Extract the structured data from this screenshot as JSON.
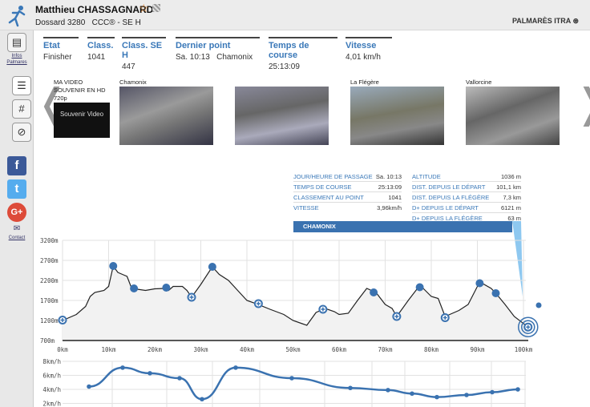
{
  "header": {
    "name": "Matthieu CHASSAGNARD",
    "dossard": "Dossard 3280   CCC® - SE H",
    "palmares": "PALMARÈS ITRA ⊛"
  },
  "sidebar": {
    "infos": "Infos",
    "palmares": "Palmares",
    "contact": "Contact"
  },
  "stats": [
    {
      "label": "Etat",
      "value": "Finisher"
    },
    {
      "label": "Class.",
      "value": "1041"
    },
    {
      "label": "Class. SE H",
      "value": "447"
    },
    {
      "label": "Dernier point",
      "value": "Sa. 10:13   Chamonix"
    },
    {
      "label": "Temps de course",
      "value": "25:13:09"
    },
    {
      "label": "Vitesse",
      "value": "4,01 km/h"
    }
  ],
  "videos": {
    "souvenir": "MA VIDEO SOUVENIR EN HD 720p",
    "souvenir_img": "Souvenir Video",
    "thumbs": [
      "Chamonix",
      "",
      "La Flégère",
      "Vallorcine"
    ]
  },
  "info_left": [
    [
      "JOUR/HEURE DE PASSAGE",
      "Sa. 10:13"
    ],
    [
      "TEMPS DE COURSE",
      "25:13:09"
    ],
    [
      "CLASSEMENT AU POINT",
      "1041"
    ],
    [
      "VITESSE",
      "3,96km/h"
    ]
  ],
  "info_right": [
    [
      "ALTITUDE",
      "1036 m"
    ],
    [
      "DIST. DEPUIS LE DÉPART",
      "101,1 km"
    ],
    [
      "DIST. DEPUIS LA FLÉGÈRE",
      "7,3 km"
    ],
    [
      "D+ DEPUIS LE DÉPART",
      "6121 m"
    ],
    [
      "D+ DEPUIS LA FLÉGÈRE",
      "63 m"
    ]
  ],
  "banner": "CHAMONIX",
  "colors": {
    "accent": "#3a72b0",
    "line": "#222222",
    "fill": "#f2f2f2"
  },
  "chart_data": [
    {
      "type": "area",
      "xlim": [
        0,
        100
      ],
      "ylim": [
        700,
        3200
      ],
      "xticks": [
        "0km",
        "10km",
        "20km",
        "30km",
        "40km",
        "50km",
        "60km",
        "70km",
        "80km",
        "90km",
        "100km"
      ],
      "yticks": [
        "3200m",
        "2700m",
        "2200m",
        "1700m",
        "1200m",
        "700m"
      ],
      "profile": [
        [
          0,
          1200
        ],
        [
          3,
          1350
        ],
        [
          5,
          1550
        ],
        [
          6,
          1800
        ],
        [
          7,
          1900
        ],
        [
          9,
          1950
        ],
        [
          10,
          2050
        ],
        [
          11,
          2560
        ],
        [
          12,
          2400
        ],
        [
          13,
          2350
        ],
        [
          14,
          2300
        ],
        [
          15,
          2000
        ],
        [
          18,
          1950
        ],
        [
          20,
          1990
        ],
        [
          22,
          2000
        ],
        [
          23,
          1950
        ],
        [
          24,
          2050
        ],
        [
          26,
          2050
        ],
        [
          27,
          1950
        ],
        [
          28,
          1780
        ],
        [
          30,
          2100
        ],
        [
          32.5,
          2540
        ],
        [
          34,
          2350
        ],
        [
          36,
          2200
        ],
        [
          38,
          1950
        ],
        [
          40,
          1700
        ],
        [
          42,
          1620
        ],
        [
          45,
          1480
        ],
        [
          48,
          1350
        ],
        [
          50,
          1200
        ],
        [
          52,
          1120
        ],
        [
          53,
          1080
        ],
        [
          55,
          1400
        ],
        [
          57,
          1500
        ],
        [
          59,
          1420
        ],
        [
          60,
          1350
        ],
        [
          62,
          1380
        ],
        [
          64,
          1700
        ],
        [
          66,
          2000
        ],
        [
          68,
          1900
        ],
        [
          70,
          1600
        ],
        [
          71.5,
          1500
        ],
        [
          72.5,
          1300
        ],
        [
          75,
          1700
        ],
        [
          77,
          2000
        ],
        [
          78,
          2030
        ],
        [
          80,
          1800
        ],
        [
          81.5,
          1750
        ],
        [
          83,
          1300
        ],
        [
          86,
          1450
        ],
        [
          88,
          1600
        ],
        [
          90,
          2050
        ],
        [
          91,
          2130
        ],
        [
          93,
          2000
        ],
        [
          94,
          1880
        ],
        [
          96,
          1600
        ],
        [
          98,
          1300
        ],
        [
          101,
          1036
        ]
      ],
      "checkpoints_filled": [
        [
          11,
          2560
        ],
        [
          15.5,
          2000
        ],
        [
          22.5,
          2020
        ],
        [
          32.5,
          2540
        ],
        [
          67.5,
          1900
        ],
        [
          77.5,
          2030
        ],
        [
          90.5,
          2130
        ],
        [
          94,
          1880
        ]
      ],
      "checkpoints_open": [
        [
          0,
          1210
        ],
        [
          28,
          1780
        ],
        [
          42.5,
          1620
        ],
        [
          56.5,
          1480
        ],
        [
          72.5,
          1300
        ],
        [
          83,
          1270
        ],
        [
          101,
          1036
        ]
      ]
    },
    {
      "type": "line",
      "ylim": [
        2,
        8
      ],
      "yticks": [
        "8km/h",
        "6km/h",
        "4km/h",
        "2km/h"
      ],
      "values": [
        4.4,
        7.1,
        6.3,
        5.6,
        2.6,
        7.1,
        5.6,
        4.2,
        3.9,
        3.4,
        2.9,
        3.2,
        3.6,
        4.0
      ]
    }
  ]
}
